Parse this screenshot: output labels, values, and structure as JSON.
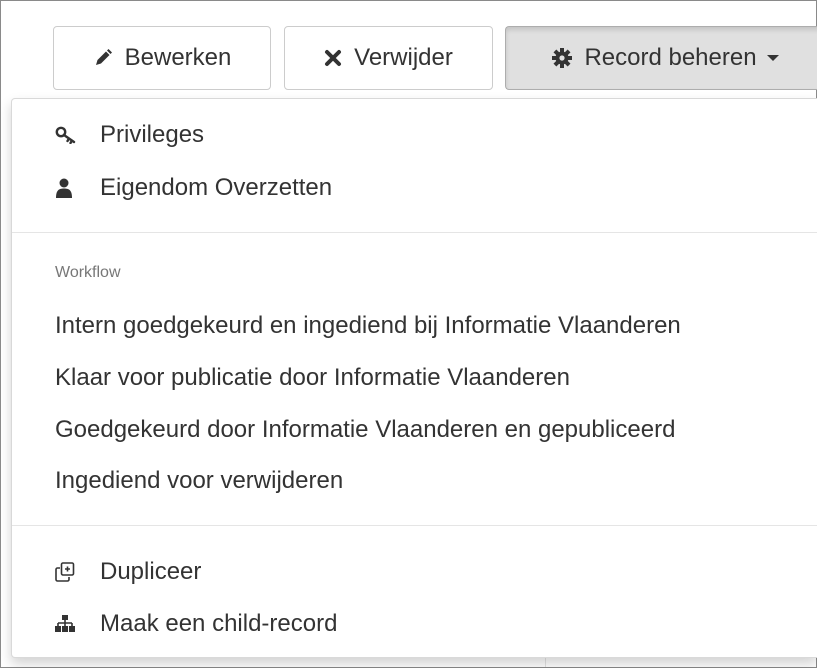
{
  "toolbar": {
    "edit": {
      "label": "Bewerken",
      "icon": "pencil-icon"
    },
    "delete": {
      "label": "Verwijder",
      "icon": "close-icon"
    },
    "manage": {
      "label": "Record beheren",
      "icon": "gear-icon"
    }
  },
  "menu": {
    "privileges": {
      "label": "Privileges",
      "icon": "key-icon"
    },
    "transfer": {
      "label": "Eigendom Overzetten",
      "icon": "user-icon"
    },
    "workflow_header": "Workflow",
    "workflow": [
      {
        "label": "Intern goedgekeurd en ingediend bij Informatie Vlaanderen"
      },
      {
        "label": "Klaar voor publicatie door Informatie Vlaanderen"
      },
      {
        "label": "Goedgekeurd door Informatie Vlaanderen en gepubliceerd"
      },
      {
        "label": "Ingediend voor verwijderen"
      }
    ],
    "duplicate": {
      "label": "Dupliceer",
      "icon": "duplicate-icon"
    },
    "child": {
      "label": "Maak een child-record",
      "icon": "sitemap-icon"
    }
  }
}
